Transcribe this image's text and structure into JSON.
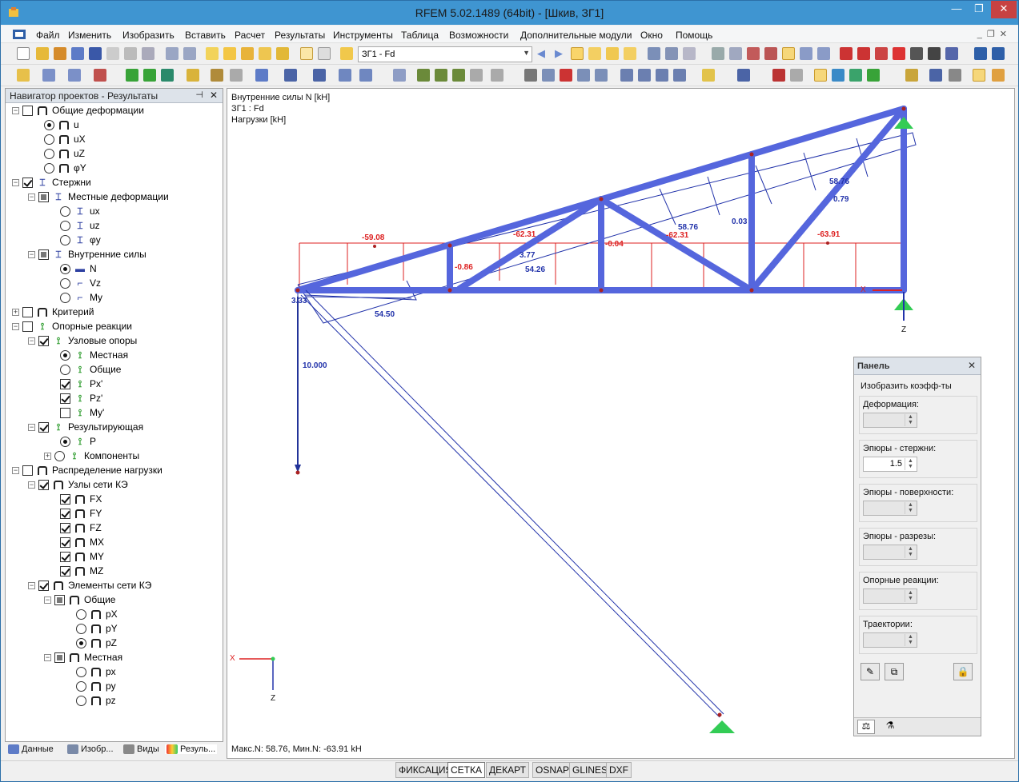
{
  "window": {
    "title": "RFEM 5.02.1489 (64bit) - [Шкив, ЗГ1]"
  },
  "menu": [
    "Файл",
    "Изменить",
    "Изобразить",
    "Вставить",
    "Расчет",
    "Результаты",
    "Инструменты",
    "Таблица",
    "Возможности",
    "Дополнительные модули",
    "Окно",
    "Помощь"
  ],
  "toolbar": {
    "load_case": "ЗГ1 - Fd"
  },
  "navigator": {
    "title": "Навигатор проектов - Результаты",
    "items": [
      {
        "label": "Общие деформации"
      },
      {
        "label": "u"
      },
      {
        "label": "uX"
      },
      {
        "label": "uZ"
      },
      {
        "label": "φY"
      },
      {
        "label": "Стержни"
      },
      {
        "label": "Местные деформации"
      },
      {
        "label": "ux"
      },
      {
        "label": "uz"
      },
      {
        "label": "φy"
      },
      {
        "label": "Внутренние силы"
      },
      {
        "label": "N"
      },
      {
        "label": "Vz"
      },
      {
        "label": "My"
      },
      {
        "label": "Критерий"
      },
      {
        "label": "Опорные реакции"
      },
      {
        "label": "Узловые опоры"
      },
      {
        "label": "Местная"
      },
      {
        "label": "Общие"
      },
      {
        "label": "Px'"
      },
      {
        "label": "Pz'"
      },
      {
        "label": "My'"
      },
      {
        "label": "Результирующая"
      },
      {
        "label": "P"
      },
      {
        "label": "Компоненты"
      },
      {
        "label": "Распределение нагрузки"
      },
      {
        "label": "Узлы сети КЭ"
      },
      {
        "label": "FX"
      },
      {
        "label": "FY"
      },
      {
        "label": "FZ"
      },
      {
        "label": "MX"
      },
      {
        "label": "MY"
      },
      {
        "label": "MZ"
      },
      {
        "label": "Элементы сети КЭ"
      },
      {
        "label": "Общие"
      },
      {
        "label": "pX"
      },
      {
        "label": "pY"
      },
      {
        "label": "pZ"
      },
      {
        "label": "Местная"
      },
      {
        "label": "px"
      },
      {
        "label": "py"
      },
      {
        "label": "pz"
      }
    ],
    "tabs": [
      "Данные",
      "Изобр...",
      "Виды",
      "Резуль..."
    ]
  },
  "canvas": {
    "info": [
      "Внутренние силы N [kH]",
      "ЗГ1 : Fd",
      "Нагрузки [kH]"
    ],
    "summary": "Макс.N: 58.76, Мин.N: -63.91 kH",
    "labels_red": [
      "-59.08",
      "-62.31",
      "-0.86",
      "-0.04",
      "-62.31",
      "-63.91"
    ],
    "labels_blue": [
      "3.77",
      "54.26",
      "58.76",
      "58.76",
      "0.79",
      "0.03",
      "54.50",
      "3.33",
      "10.000"
    ],
    "axis_x": "X",
    "axis_z": "Z"
  },
  "panel": {
    "title": "Панель",
    "subtitle": "Изобразить коэфф-ты",
    "groups": [
      {
        "label": "Деформация:",
        "value": ""
      },
      {
        "label": "Эпюры - стержни:",
        "value": "1.5"
      },
      {
        "label": "Эпюры - поверхности:",
        "value": ""
      },
      {
        "label": "Эпюры - разрезы:",
        "value": ""
      },
      {
        "label": "Опорные реакции:",
        "value": ""
      },
      {
        "label": "Траектории:",
        "value": ""
      }
    ]
  },
  "statusbar": [
    "ФИКСАЦИЯ",
    "СЕТКА",
    "ДЕКАРТ",
    "OSNAP",
    "GLINES",
    "DXF"
  ],
  "colors": {
    "member": "#5566dd",
    "diagram_red": "#dd2222",
    "diagram_blue": "#2233aa",
    "support": "#33cc55"
  }
}
